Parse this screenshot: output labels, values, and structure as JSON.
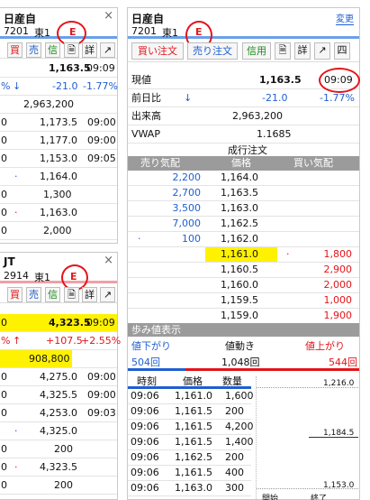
{
  "panelA": {
    "name": "日産自",
    "code": "7201",
    "market": "東1",
    "tag": "E",
    "close": "×",
    "buttons": [
      "買",
      "売",
      "信"
    ],
    "rows": [
      [
        "1,163.5",
        "09:09"
      ],
      [
        "-21.0",
        "-1.77%"
      ],
      [
        "2,963,200",
        ""
      ],
      [
        "1,173.5",
        "09:00"
      ],
      [
        "1,177.0",
        "09:00"
      ],
      [
        "1,153.0",
        "09:05"
      ],
      [
        "1,164.0",
        ""
      ],
      [
        "1,300",
        ""
      ],
      [
        "1,163.0",
        ""
      ],
      [
        "2,000",
        ""
      ]
    ],
    "left_marks": [
      "%",
      "0",
      "0",
      "0",
      "0",
      "0",
      "0",
      "0"
    ]
  },
  "panelB": {
    "name": "JT",
    "code": "2914",
    "market": "東1",
    "tag": "E",
    "close": "×",
    "buttons": [
      "買",
      "売",
      "信"
    ],
    "rows": [
      [
        "4,323.5",
        "09:09"
      ],
      [
        "+107.5",
        "+2.55%"
      ],
      [
        "908,800",
        ""
      ],
      [
        "4,275.0",
        "09:00"
      ],
      [
        "4,325.5",
        "09:00"
      ],
      [
        "4,253.0",
        "09:03"
      ],
      [
        "4,325.0",
        ""
      ],
      [
        "200",
        ""
      ],
      [
        "4,323.5",
        ""
      ],
      [
        "200",
        ""
      ]
    ],
    "left_marks": [
      "0",
      "%",
      "0",
      "0",
      "0",
      "0",
      "0",
      "0"
    ]
  },
  "panelC": {
    "name": "日産自",
    "code": "7201",
    "market": "東1",
    "tag": "E",
    "change_label": "変更",
    "buttons": [
      "買い注文",
      "売り注文",
      "信用"
    ],
    "info": [
      {
        "label": "現値",
        "value": "1,163.5",
        "extra": "09:09"
      },
      {
        "label": "前日比",
        "value": "-21.0",
        "extra": "-1.77%"
      },
      {
        "label": "出来高",
        "value": "2,963,200",
        "extra": ""
      },
      {
        "label": "VWAP",
        "value": "1.1685",
        "extra": ""
      }
    ],
    "board_title": "成行注文",
    "board_headers": [
      "売り気配",
      "価格",
      "買い気配"
    ],
    "board": [
      {
        "sell": "2,200",
        "price": "1,164.0",
        "buy": ""
      },
      {
        "sell": "2,700",
        "price": "1,163.5",
        "buy": ""
      },
      {
        "sell": "3,500",
        "price": "1,163.0",
        "buy": ""
      },
      {
        "sell": "7,000",
        "price": "1,162.5",
        "buy": ""
      },
      {
        "sell": "100",
        "price": "1,162.0",
        "buy": ""
      },
      {
        "sell": "",
        "price": "1,161.0",
        "buy": "1,800"
      },
      {
        "sell": "",
        "price": "1,160.5",
        "buy": "2,900"
      },
      {
        "sell": "",
        "price": "1,160.0",
        "buy": "2,000"
      },
      {
        "sell": "",
        "price": "1,159.5",
        "buy": "1,000"
      },
      {
        "sell": "",
        "price": "1,159.0",
        "buy": "1,900"
      }
    ],
    "ticks_title": "歩み値表示",
    "trend": {
      "down_label": "値下がり",
      "move_label": "値動き",
      "up_label": "値上がり",
      "down_count": "504回",
      "move_count": "1,048回",
      "up_count": "544回"
    },
    "tick_headers": [
      "時刻",
      "価格",
      "数量"
    ],
    "ticks": [
      [
        "09:06",
        "1,161.0",
        "1,600"
      ],
      [
        "09:06",
        "1,161.5",
        "200"
      ],
      [
        "09:06",
        "1,161.5",
        "4,200"
      ],
      [
        "09:06",
        "1,161.5",
        "1,400"
      ],
      [
        "09:06",
        "1,162.5",
        "200"
      ],
      [
        "09:06",
        "1,161.5",
        "400"
      ],
      [
        "09:06",
        "1,163.0",
        "300"
      ]
    ],
    "mini_axis": [
      "1,216.0",
      "1,184.5",
      "1,153.0"
    ],
    "mini_footer": [
      "開始",
      "終了"
    ]
  }
}
